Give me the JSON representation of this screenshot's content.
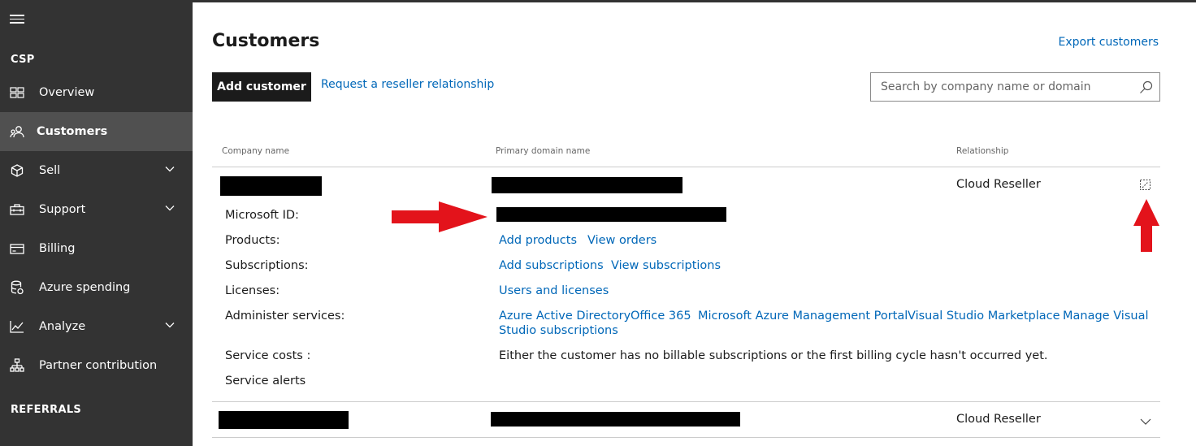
{
  "sidebar": {
    "section_csp": "CSP",
    "items": [
      {
        "label": "Overview",
        "icon": "overview-icon"
      },
      {
        "label": "Customers",
        "icon": "customers-icon",
        "active": true
      },
      {
        "label": "Sell",
        "icon": "box-icon",
        "expandable": true
      },
      {
        "label": "Support",
        "icon": "toolbox-icon",
        "expandable": true
      },
      {
        "label": "Billing",
        "icon": "billing-icon"
      },
      {
        "label": "Azure spending",
        "icon": "database-icon"
      },
      {
        "label": "Analyze",
        "icon": "chart-icon",
        "expandable": true
      },
      {
        "label": "Partner contribution",
        "icon": "hierarchy-icon"
      }
    ],
    "section_referrals": "REFERRALS"
  },
  "header": {
    "title": "Customers",
    "export_label": "Export customers",
    "add_customer_label": "Add customer",
    "reseller_link_label": "Request a reseller relationship",
    "search_placeholder": "Search by company name or domain"
  },
  "table": {
    "columns": [
      "Company name",
      "Primary domain name",
      "Relationship"
    ],
    "rows": [
      {
        "relationship": "Cloud Reseller",
        "expanded": true,
        "details": {
          "microsoft_id_label": "Microsoft ID:",
          "products_label": "Products:",
          "products_links": [
            "Add products",
            "View orders"
          ],
          "subscriptions_label": "Subscriptions:",
          "subscriptions_links": [
            "Add subscriptions",
            "View subscriptions"
          ],
          "licenses_label": "Licenses:",
          "licenses_links": [
            "Users and licenses"
          ],
          "administer_label": "Administer services:",
          "administer_links": [
            "Azure Active Directory",
            "Office 365",
            "Microsoft Azure Management Portal",
            "Visual Studio Marketplace",
            "Manage Visual",
            "Studio subscriptions"
          ],
          "service_costs_label": "Service costs :",
          "service_costs_text": "Either the customer has no billable subscriptions or the first billing cycle hasn't occurred yet.",
          "service_alerts_label": "Service alerts"
        }
      },
      {
        "relationship": "Cloud Reseller",
        "expanded": false
      }
    ]
  },
  "colors": {
    "sidebar_bg": "#333333",
    "sidebar_active": "#505050",
    "link": "#0067b8",
    "annotation_arrow": "#e3131b"
  }
}
